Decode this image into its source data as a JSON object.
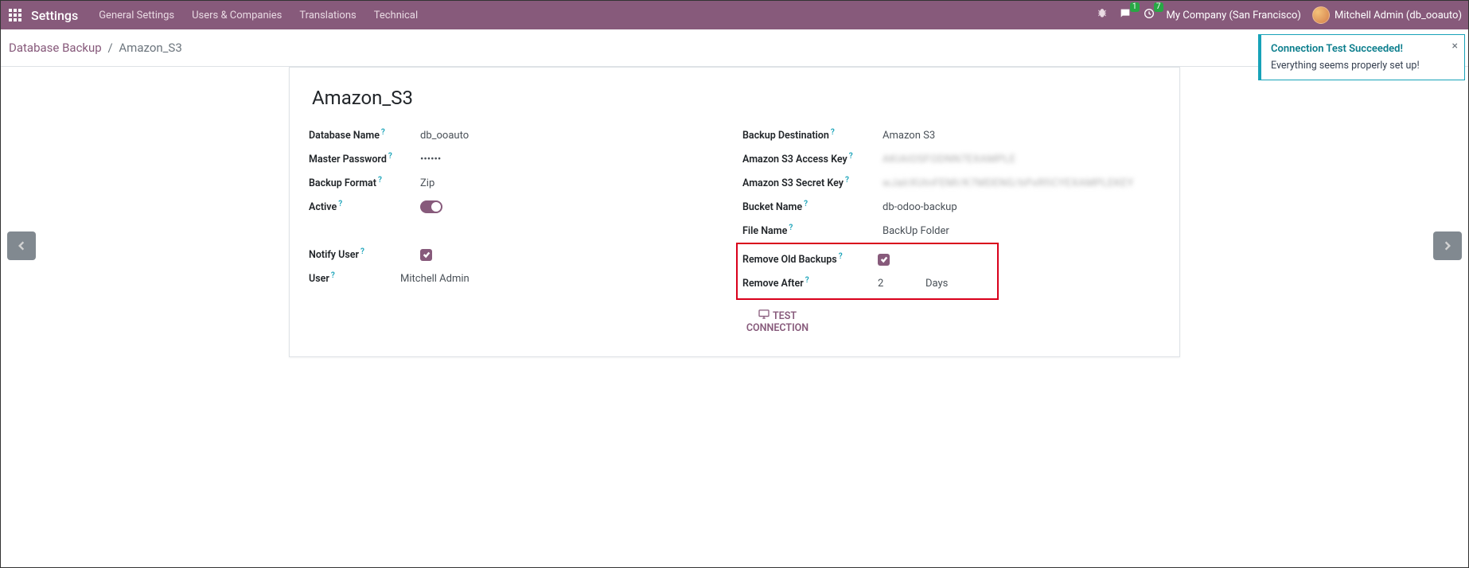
{
  "topbar": {
    "title": "Settings",
    "menu": [
      "General Settings",
      "Users & Companies",
      "Translations",
      "Technical"
    ],
    "chat_badge": "1",
    "clock_badge": "7",
    "company": "My Company (San Francisco)",
    "user": "Mitchell Admin (db_ooauto)"
  },
  "breadcrumb": {
    "root": "Database Backup",
    "sep": "/",
    "current": "Amazon_S3"
  },
  "form": {
    "title": "Amazon_S3",
    "left": {
      "db_name_label": "Database Name",
      "db_name_value": "db_ooauto",
      "master_pw_label": "Master Password",
      "master_pw_value": "••••••",
      "backup_fmt_label": "Backup Format",
      "backup_fmt_value": "Zip",
      "active_label": "Active",
      "notify_label": "Notify User",
      "user_label": "User",
      "user_value": "Mitchell Admin"
    },
    "right": {
      "dest_label": "Backup Destination",
      "dest_value": "Amazon S3",
      "access_label": "Amazon S3 Access Key",
      "access_value": "AKIAIOSFODNN7EXAMPLE",
      "secret_label": "Amazon S3 Secret Key",
      "secret_value": "wJalrXUtnFEMI/K7MDENG/bPxRfiCYEXAMPLEKEY",
      "bucket_label": "Bucket Name",
      "bucket_value": "db-odoo-backup",
      "file_label": "File Name",
      "file_value": "BackUp Folder",
      "remove_old_label": "Remove Old Backups",
      "remove_after_label": "Remove After",
      "remove_after_value": "2",
      "remove_after_unit": "Days",
      "test_conn": "TEST CONNECTION"
    }
  },
  "toast": {
    "title": "Connection Test Succeeded!",
    "body": "Everything seems properly set up!",
    "close": "×"
  }
}
